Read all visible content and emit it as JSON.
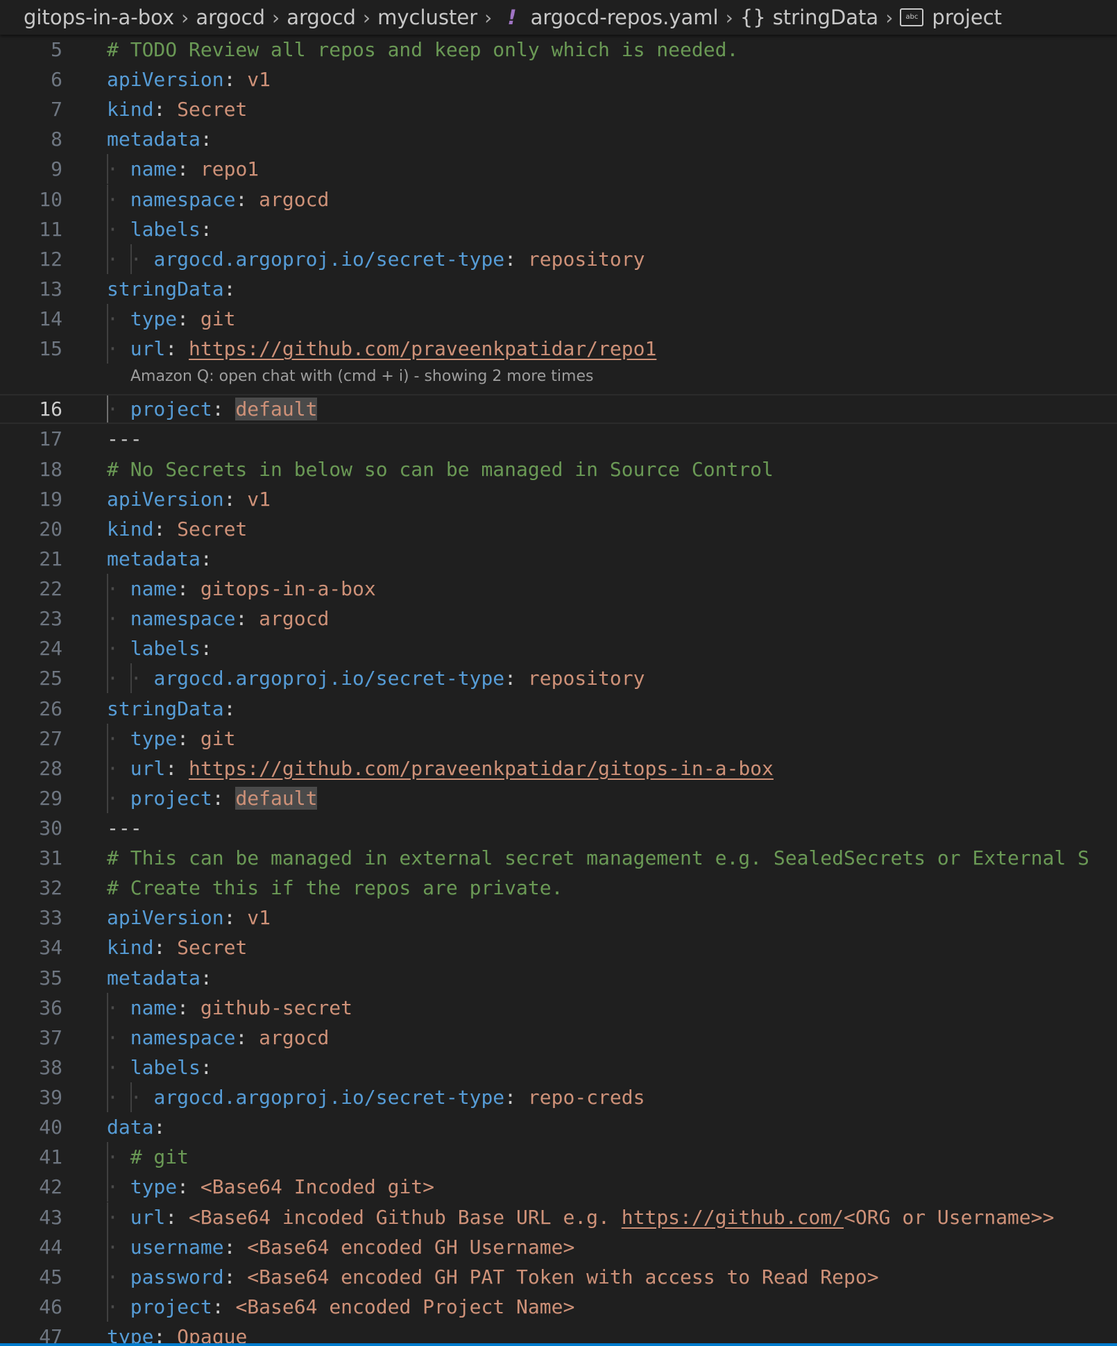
{
  "breadcrumbs": [
    {
      "label": "gitops-in-a-box",
      "icon": null
    },
    {
      "label": "argocd",
      "icon": null
    },
    {
      "label": "argocd",
      "icon": null
    },
    {
      "label": "mycluster",
      "icon": null
    },
    {
      "label": "argocd-repos.yaml",
      "icon": "yaml-file-icon",
      "glyph": "!"
    },
    {
      "label": "stringData",
      "icon": "object-icon",
      "glyph": "{}"
    },
    {
      "label": "project",
      "icon": "string-icon",
      "glyph": "abc"
    }
  ],
  "hint": "Amazon Q: open chat with (cmd + i) - showing 2 more times",
  "current_line": 16,
  "lines": [
    {
      "n": "5",
      "indent": 0,
      "parts": [
        {
          "t": "c",
          "s": "# TODO Review all repos and keep only which is needed."
        }
      ]
    },
    {
      "n": "6",
      "indent": 0,
      "parts": [
        {
          "t": "k",
          "s": "apiVersion"
        },
        {
          "t": "p",
          "s": ": "
        },
        {
          "t": "v",
          "s": "v1"
        }
      ]
    },
    {
      "n": "7",
      "indent": 0,
      "parts": [
        {
          "t": "k",
          "s": "kind"
        },
        {
          "t": "p",
          "s": ": "
        },
        {
          "t": "v",
          "s": "Secret"
        }
      ]
    },
    {
      "n": "8",
      "indent": 0,
      "parts": [
        {
          "t": "k",
          "s": "metadata"
        },
        {
          "t": "p",
          "s": ":"
        }
      ]
    },
    {
      "n": "9",
      "indent": 1,
      "parts": [
        {
          "t": "k",
          "s": "name"
        },
        {
          "t": "p",
          "s": ": "
        },
        {
          "t": "v",
          "s": "repo1"
        }
      ]
    },
    {
      "n": "10",
      "indent": 1,
      "parts": [
        {
          "t": "k",
          "s": "namespace"
        },
        {
          "t": "p",
          "s": ": "
        },
        {
          "t": "v",
          "s": "argocd"
        }
      ]
    },
    {
      "n": "11",
      "indent": 1,
      "parts": [
        {
          "t": "k",
          "s": "labels"
        },
        {
          "t": "p",
          "s": ":"
        }
      ]
    },
    {
      "n": "12",
      "indent": 2,
      "parts": [
        {
          "t": "k",
          "s": "argocd.argoproj.io/secret-type"
        },
        {
          "t": "p",
          "s": ": "
        },
        {
          "t": "v",
          "s": "repository"
        }
      ]
    },
    {
      "n": "13",
      "indent": 0,
      "parts": [
        {
          "t": "k",
          "s": "stringData"
        },
        {
          "t": "p",
          "s": ":"
        }
      ]
    },
    {
      "n": "14",
      "indent": 1,
      "parts": [
        {
          "t": "k",
          "s": "type"
        },
        {
          "t": "p",
          "s": ": "
        },
        {
          "t": "v",
          "s": "git"
        }
      ]
    },
    {
      "n": "15",
      "indent": 1,
      "parts": [
        {
          "t": "k",
          "s": "url"
        },
        {
          "t": "p",
          "s": ": "
        },
        {
          "t": "u",
          "s": "https://github.com/praveenkpatidar/repo1"
        }
      ]
    },
    {
      "n": "16",
      "indent": 1,
      "parts": [
        {
          "t": "k",
          "s": "project"
        },
        {
          "t": "p",
          "s": ": "
        },
        {
          "t": "vh",
          "s": "default"
        }
      ]
    },
    {
      "n": "17",
      "indent": 0,
      "parts": [
        {
          "t": "sep",
          "s": "---"
        }
      ]
    },
    {
      "n": "18",
      "indent": 0,
      "parts": [
        {
          "t": "c",
          "s": "# No Secrets in below so can be managed in Source Control"
        }
      ]
    },
    {
      "n": "19",
      "indent": 0,
      "parts": [
        {
          "t": "k",
          "s": "apiVersion"
        },
        {
          "t": "p",
          "s": ": "
        },
        {
          "t": "v",
          "s": "v1"
        }
      ]
    },
    {
      "n": "20",
      "indent": 0,
      "parts": [
        {
          "t": "k",
          "s": "kind"
        },
        {
          "t": "p",
          "s": ": "
        },
        {
          "t": "v",
          "s": "Secret"
        }
      ]
    },
    {
      "n": "21",
      "indent": 0,
      "parts": [
        {
          "t": "k",
          "s": "metadata"
        },
        {
          "t": "p",
          "s": ":"
        }
      ]
    },
    {
      "n": "22",
      "indent": 1,
      "parts": [
        {
          "t": "k",
          "s": "name"
        },
        {
          "t": "p",
          "s": ": "
        },
        {
          "t": "v",
          "s": "gitops-in-a-box"
        }
      ]
    },
    {
      "n": "23",
      "indent": 1,
      "parts": [
        {
          "t": "k",
          "s": "namespace"
        },
        {
          "t": "p",
          "s": ": "
        },
        {
          "t": "v",
          "s": "argocd"
        }
      ]
    },
    {
      "n": "24",
      "indent": 1,
      "parts": [
        {
          "t": "k",
          "s": "labels"
        },
        {
          "t": "p",
          "s": ":"
        }
      ]
    },
    {
      "n": "25",
      "indent": 2,
      "parts": [
        {
          "t": "k",
          "s": "argocd.argoproj.io/secret-type"
        },
        {
          "t": "p",
          "s": ": "
        },
        {
          "t": "v",
          "s": "repository"
        }
      ]
    },
    {
      "n": "26",
      "indent": 0,
      "parts": [
        {
          "t": "k",
          "s": "stringData"
        },
        {
          "t": "p",
          "s": ":"
        }
      ]
    },
    {
      "n": "27",
      "indent": 1,
      "parts": [
        {
          "t": "k",
          "s": "type"
        },
        {
          "t": "p",
          "s": ": "
        },
        {
          "t": "v",
          "s": "git"
        }
      ]
    },
    {
      "n": "28",
      "indent": 1,
      "parts": [
        {
          "t": "k",
          "s": "url"
        },
        {
          "t": "p",
          "s": ": "
        },
        {
          "t": "u",
          "s": "https://github.com/praveenkpatidar/gitops-in-a-box"
        }
      ]
    },
    {
      "n": "29",
      "indent": 1,
      "parts": [
        {
          "t": "k",
          "s": "project"
        },
        {
          "t": "p",
          "s": ": "
        },
        {
          "t": "vh",
          "s": "default"
        }
      ]
    },
    {
      "n": "30",
      "indent": 0,
      "parts": [
        {
          "t": "sep",
          "s": "---"
        }
      ]
    },
    {
      "n": "31",
      "indent": 0,
      "parts": [
        {
          "t": "c",
          "s": "# This can be managed in external secret management e.g. SealedSecrets or External S"
        }
      ]
    },
    {
      "n": "32",
      "indent": 0,
      "parts": [
        {
          "t": "c",
          "s": "# Create this if the repos are private."
        }
      ]
    },
    {
      "n": "33",
      "indent": 0,
      "parts": [
        {
          "t": "k",
          "s": "apiVersion"
        },
        {
          "t": "p",
          "s": ": "
        },
        {
          "t": "v",
          "s": "v1"
        }
      ]
    },
    {
      "n": "34",
      "indent": 0,
      "parts": [
        {
          "t": "k",
          "s": "kind"
        },
        {
          "t": "p",
          "s": ": "
        },
        {
          "t": "v",
          "s": "Secret"
        }
      ]
    },
    {
      "n": "35",
      "indent": 0,
      "parts": [
        {
          "t": "k",
          "s": "metadata"
        },
        {
          "t": "p",
          "s": ":"
        }
      ]
    },
    {
      "n": "36",
      "indent": 1,
      "parts": [
        {
          "t": "k",
          "s": "name"
        },
        {
          "t": "p",
          "s": ": "
        },
        {
          "t": "v",
          "s": "github-secret"
        }
      ]
    },
    {
      "n": "37",
      "indent": 1,
      "parts": [
        {
          "t": "k",
          "s": "namespace"
        },
        {
          "t": "p",
          "s": ": "
        },
        {
          "t": "v",
          "s": "argocd"
        }
      ]
    },
    {
      "n": "38",
      "indent": 1,
      "parts": [
        {
          "t": "k",
          "s": "labels"
        },
        {
          "t": "p",
          "s": ":"
        }
      ]
    },
    {
      "n": "39",
      "indent": 2,
      "parts": [
        {
          "t": "k",
          "s": "argocd.argoproj.io/secret-type"
        },
        {
          "t": "p",
          "s": ": "
        },
        {
          "t": "v",
          "s": "repo-creds"
        }
      ]
    },
    {
      "n": "40",
      "indent": 0,
      "parts": [
        {
          "t": "k",
          "s": "data"
        },
        {
          "t": "p",
          "s": ":"
        }
      ]
    },
    {
      "n": "41",
      "indent": 1,
      "parts": [
        {
          "t": "c",
          "s": "# git"
        }
      ]
    },
    {
      "n": "42",
      "indent": 1,
      "parts": [
        {
          "t": "k",
          "s": "type"
        },
        {
          "t": "p",
          "s": ": "
        },
        {
          "t": "v",
          "s": "<Base64 Incoded git>"
        }
      ]
    },
    {
      "n": "43",
      "indent": 1,
      "parts": [
        {
          "t": "k",
          "s": "url"
        },
        {
          "t": "p",
          "s": ": "
        },
        {
          "t": "v",
          "s": "<Base64 incoded Github Base URL e.g. "
        },
        {
          "t": "u",
          "s": "https://github.com/"
        },
        {
          "t": "v",
          "s": "<ORG or Username>>"
        }
      ]
    },
    {
      "n": "44",
      "indent": 1,
      "parts": [
        {
          "t": "k",
          "s": "username"
        },
        {
          "t": "p",
          "s": ": "
        },
        {
          "t": "v",
          "s": "<Base64 encoded GH Username>"
        }
      ]
    },
    {
      "n": "45",
      "indent": 1,
      "parts": [
        {
          "t": "k",
          "s": "password"
        },
        {
          "t": "p",
          "s": ": "
        },
        {
          "t": "v",
          "s": "<Base64 encoded GH PAT Token with access to Read Repo>"
        }
      ]
    },
    {
      "n": "46",
      "indent": 1,
      "parts": [
        {
          "t": "k",
          "s": "project"
        },
        {
          "t": "p",
          "s": ": "
        },
        {
          "t": "v",
          "s": "<Base64 encoded Project Name>"
        }
      ]
    },
    {
      "n": "47",
      "indent": 0,
      "parts": [
        {
          "t": "k",
          "s": "type"
        },
        {
          "t": "p",
          "s": ": "
        },
        {
          "t": "v",
          "s": "Opaque"
        }
      ]
    }
  ]
}
